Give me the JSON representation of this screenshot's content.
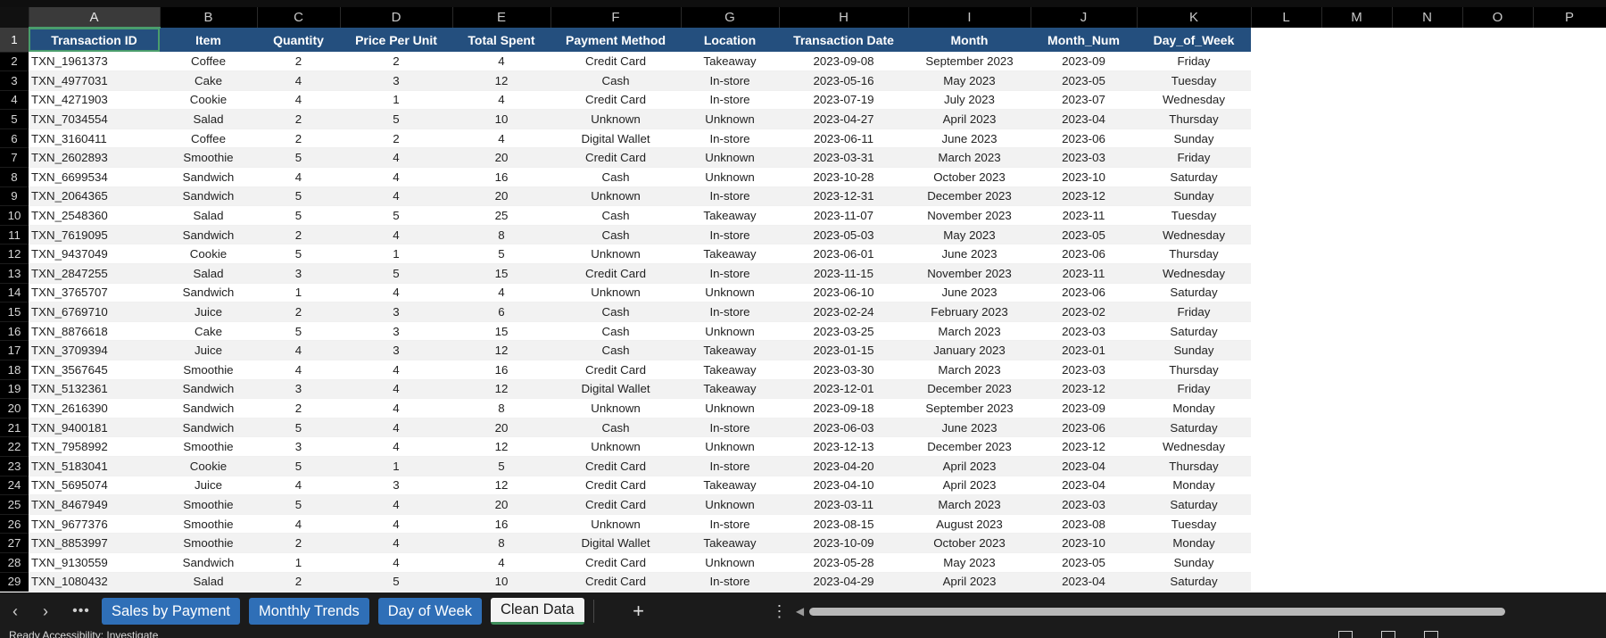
{
  "columns": [
    "A",
    "B",
    "C",
    "D",
    "E",
    "F",
    "G",
    "H",
    "I",
    "J",
    "K",
    "L",
    "M",
    "N",
    "O",
    "P"
  ],
  "headers": [
    "Transaction ID",
    "Item",
    "Quantity",
    "Price Per Unit",
    "Total Spent",
    "Payment Method",
    "Location",
    "Transaction Date",
    "Month",
    "Month_Num",
    "Day_of_Week"
  ],
  "rows": [
    [
      "TXN_1961373",
      "Coffee",
      "2",
      "2",
      "4",
      "Credit Card",
      "Takeaway",
      "2023-09-08",
      "September 2023",
      "2023-09",
      "Friday"
    ],
    [
      "TXN_4977031",
      "Cake",
      "4",
      "3",
      "12",
      "Cash",
      "In-store",
      "2023-05-16",
      "May 2023",
      "2023-05",
      "Tuesday"
    ],
    [
      "TXN_4271903",
      "Cookie",
      "4",
      "1",
      "4",
      "Credit Card",
      "In-store",
      "2023-07-19",
      "July 2023",
      "2023-07",
      "Wednesday"
    ],
    [
      "TXN_7034554",
      "Salad",
      "2",
      "5",
      "10",
      "Unknown",
      "Unknown",
      "2023-04-27",
      "April 2023",
      "2023-04",
      "Thursday"
    ],
    [
      "TXN_3160411",
      "Coffee",
      "2",
      "2",
      "4",
      "Digital Wallet",
      "In-store",
      "2023-06-11",
      "June 2023",
      "2023-06",
      "Sunday"
    ],
    [
      "TXN_2602893",
      "Smoothie",
      "5",
      "4",
      "20",
      "Credit Card",
      "Unknown",
      "2023-03-31",
      "March 2023",
      "2023-03",
      "Friday"
    ],
    [
      "TXN_6699534",
      "Sandwich",
      "4",
      "4",
      "16",
      "Cash",
      "Unknown",
      "2023-10-28",
      "October 2023",
      "2023-10",
      "Saturday"
    ],
    [
      "TXN_2064365",
      "Sandwich",
      "5",
      "4",
      "20",
      "Unknown",
      "In-store",
      "2023-12-31",
      "December 2023",
      "2023-12",
      "Sunday"
    ],
    [
      "TXN_2548360",
      "Salad",
      "5",
      "5",
      "25",
      "Cash",
      "Takeaway",
      "2023-11-07",
      "November 2023",
      "2023-11",
      "Tuesday"
    ],
    [
      "TXN_7619095",
      "Sandwich",
      "2",
      "4",
      "8",
      "Cash",
      "In-store",
      "2023-05-03",
      "May 2023",
      "2023-05",
      "Wednesday"
    ],
    [
      "TXN_9437049",
      "Cookie",
      "5",
      "1",
      "5",
      "Unknown",
      "Takeaway",
      "2023-06-01",
      "June 2023",
      "2023-06",
      "Thursday"
    ],
    [
      "TXN_2847255",
      "Salad",
      "3",
      "5",
      "15",
      "Credit Card",
      "In-store",
      "2023-11-15",
      "November 2023",
      "2023-11",
      "Wednesday"
    ],
    [
      "TXN_3765707",
      "Sandwich",
      "1",
      "4",
      "4",
      "Unknown",
      "Unknown",
      "2023-06-10",
      "June 2023",
      "2023-06",
      "Saturday"
    ],
    [
      "TXN_6769710",
      "Juice",
      "2",
      "3",
      "6",
      "Cash",
      "In-store",
      "2023-02-24",
      "February 2023",
      "2023-02",
      "Friday"
    ],
    [
      "TXN_8876618",
      "Cake",
      "5",
      "3",
      "15",
      "Cash",
      "Unknown",
      "2023-03-25",
      "March 2023",
      "2023-03",
      "Saturday"
    ],
    [
      "TXN_3709394",
      "Juice",
      "4",
      "3",
      "12",
      "Cash",
      "Takeaway",
      "2023-01-15",
      "January 2023",
      "2023-01",
      "Sunday"
    ],
    [
      "TXN_3567645",
      "Smoothie",
      "4",
      "4",
      "16",
      "Credit Card",
      "Takeaway",
      "2023-03-30",
      "March 2023",
      "2023-03",
      "Thursday"
    ],
    [
      "TXN_5132361",
      "Sandwich",
      "3",
      "4",
      "12",
      "Digital Wallet",
      "Takeaway",
      "2023-12-01",
      "December 2023",
      "2023-12",
      "Friday"
    ],
    [
      "TXN_2616390",
      "Sandwich",
      "2",
      "4",
      "8",
      "Unknown",
      "Unknown",
      "2023-09-18",
      "September 2023",
      "2023-09",
      "Monday"
    ],
    [
      "TXN_9400181",
      "Sandwich",
      "5",
      "4",
      "20",
      "Cash",
      "In-store",
      "2023-06-03",
      "June 2023",
      "2023-06",
      "Saturday"
    ],
    [
      "TXN_7958992",
      "Smoothie",
      "3",
      "4",
      "12",
      "Unknown",
      "Unknown",
      "2023-12-13",
      "December 2023",
      "2023-12",
      "Wednesday"
    ],
    [
      "TXN_5183041",
      "Cookie",
      "5",
      "1",
      "5",
      "Credit Card",
      "In-store",
      "2023-04-20",
      "April 2023",
      "2023-04",
      "Thursday"
    ],
    [
      "TXN_5695074",
      "Juice",
      "4",
      "3",
      "12",
      "Credit Card",
      "Takeaway",
      "2023-04-10",
      "April 2023",
      "2023-04",
      "Monday"
    ],
    [
      "TXN_8467949",
      "Smoothie",
      "5",
      "4",
      "20",
      "Credit Card",
      "Unknown",
      "2023-03-11",
      "March 2023",
      "2023-03",
      "Saturday"
    ],
    [
      "TXN_9677376",
      "Smoothie",
      "4",
      "4",
      "16",
      "Unknown",
      "In-store",
      "2023-08-15",
      "August 2023",
      "2023-08",
      "Tuesday"
    ],
    [
      "TXN_8853997",
      "Smoothie",
      "2",
      "4",
      "8",
      "Digital Wallet",
      "Takeaway",
      "2023-10-09",
      "October 2023",
      "2023-10",
      "Monday"
    ],
    [
      "TXN_9130559",
      "Sandwich",
      "1",
      "4",
      "4",
      "Credit Card",
      "Unknown",
      "2023-05-28",
      "May 2023",
      "2023-05",
      "Sunday"
    ],
    [
      "TXN_1080432",
      "Salad",
      "2",
      "5",
      "10",
      "Credit Card",
      "In-store",
      "2023-04-29",
      "April 2023",
      "2023-04",
      "Saturday"
    ]
  ],
  "sheet_tabs": [
    {
      "label": "Sales by Payment",
      "active": false
    },
    {
      "label": "Monthly Trends",
      "active": false
    },
    {
      "label": "Day of Week",
      "active": false
    },
    {
      "label": "Clean Data",
      "active": true
    }
  ],
  "nav": {
    "prev": "‹",
    "next": "›",
    "more": "•••",
    "add": "+",
    "menu": "⋮",
    "scroll_left": "◀"
  },
  "status": {
    "text": "Ready   Accessibility: Investigate"
  },
  "icons": {
    "prev": "chevron-left-icon",
    "next": "chevron-right-icon",
    "add": "plus-icon",
    "menu": "kebab-icon"
  },
  "colors": {
    "header_fill": "#244f7e",
    "tab_fill": "#2f6fb7",
    "selection": "#4a9d6c"
  }
}
